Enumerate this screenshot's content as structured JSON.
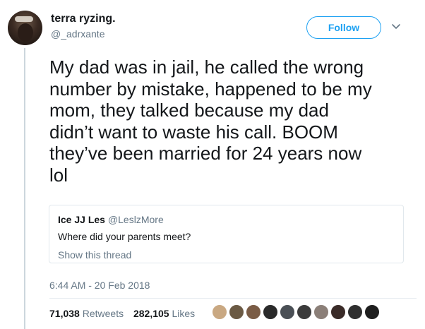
{
  "user": {
    "display_name": "terra ryzing.",
    "handle": "@_adrxante"
  },
  "follow_label": "Follow",
  "tweet_text": "My dad was in jail, he called the wrong\nnumber by mistake, happened to be my\nmom, they talked because my dad\ndidn’t want to waste his call. BOOM\nthey’ve been married for 24 years now\nlol",
  "quoted_tweet": {
    "name": "Ice JJ Les",
    "handle": "@LeslzMore",
    "text": "Where did your parents meet?",
    "show_thread": "Show this thread"
  },
  "timestamp": "6:44 AM - 20 Feb 2018",
  "stats": {
    "retweets_count": "71,038",
    "retweets_label": "Retweets",
    "likes_count": "282,105",
    "likes_label": "Likes"
  },
  "likers_colors": [
    "#c9a882",
    "#6b5a44",
    "#7a5c45",
    "#2a2a2a",
    "#4a4f55",
    "#3b3b3b",
    "#8b7f78",
    "#3a2b28",
    "#2f2f2f",
    "#1e1e1e"
  ],
  "colors": {
    "accent": "#1da1f2",
    "secondary_text": "#657786",
    "border": "#e1e8ed"
  }
}
